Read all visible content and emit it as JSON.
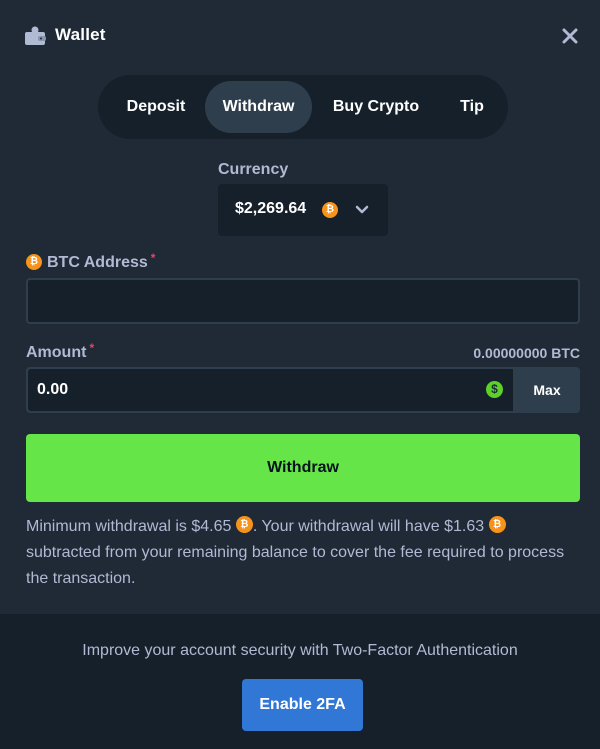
{
  "header": {
    "title": "Wallet",
    "icon": "wallet-icon",
    "close_icon": "close-icon"
  },
  "tabs": [
    {
      "label": "Deposit",
      "active": false
    },
    {
      "label": "Withdraw",
      "active": true
    },
    {
      "label": "Buy Crypto",
      "active": false
    },
    {
      "label": "Tip",
      "active": false
    }
  ],
  "currency": {
    "label": "Currency",
    "value": "$2,269.64",
    "coin_icon": "bitcoin-icon",
    "coin_glyph": "₿"
  },
  "address": {
    "label": "BTC Address",
    "required_mark": "*",
    "value": "",
    "placeholder": ""
  },
  "amount": {
    "label": "Amount",
    "required_mark": "*",
    "btc_equivalent": "0.00000000 BTC",
    "value": "0.00",
    "currency_glyph": "$",
    "max_label": "Max"
  },
  "withdraw_button": {
    "label": "Withdraw"
  },
  "info": {
    "part1": "Minimum withdrawal is $4.65 ",
    "part2": ". Your withdrawal will have $1.63 ",
    "part3": " subtracted from your remaining balance to cover the fee required to process the transaction.",
    "coin_glyph": "₿"
  },
  "footer": {
    "text": "Improve your account security with Two-Factor Authentication",
    "button_label": "Enable 2FA"
  },
  "colors": {
    "background": "#1f2a36",
    "panel": "#16202b",
    "active_tab": "#2f3e4c",
    "label": "#b1bad3",
    "bitcoin": "#f7931a",
    "withdraw_green": "#66e549",
    "enable_blue": "#3077d6",
    "required_red": "#ed4163"
  }
}
